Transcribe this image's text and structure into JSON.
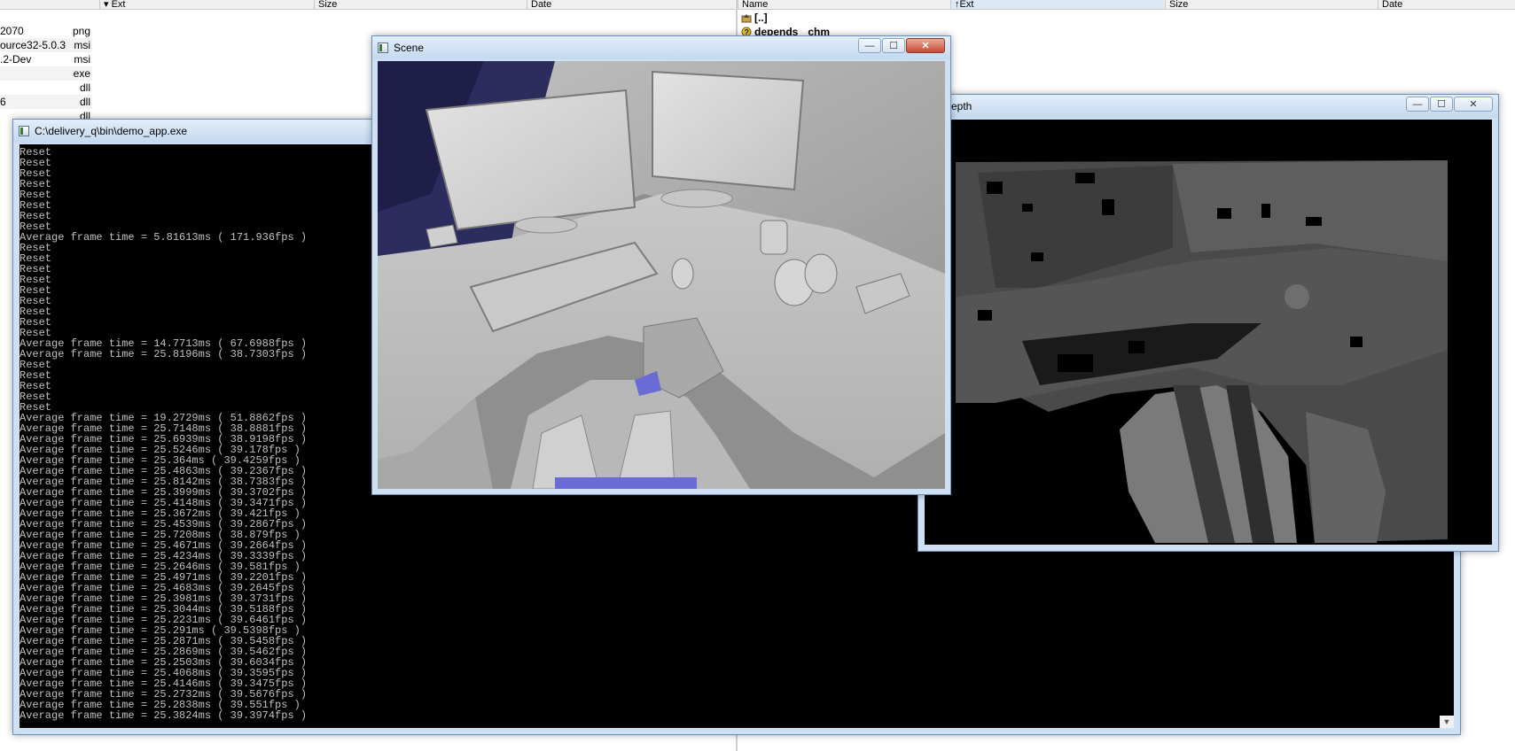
{
  "file_manager": {
    "left_headers": [
      "Ext",
      "Size",
      "Date"
    ],
    "left_rows": [
      {
        "name": "2070",
        "ext": "png"
      },
      {
        "name": "ource32-5.0.3",
        "ext": "msi"
      },
      {
        "name": ".2-Dev",
        "ext": "msi"
      },
      {
        "name": "",
        "ext": "exe"
      },
      {
        "name": "",
        "ext": "dll"
      },
      {
        "name": "6",
        "ext": "dll"
      },
      {
        "name": "",
        "ext": "dll"
      }
    ],
    "right_headers": [
      "Name",
      "Ext",
      "Size",
      "Date"
    ],
    "right_rows": [
      {
        "name": "[..]",
        "ext": ""
      },
      {
        "name": "depends",
        "ext": "chm"
      }
    ]
  },
  "console": {
    "title": "C:\\delivery_q\\bin\\demo_app.exe",
    "lines": [
      "Reset",
      "Reset",
      "Reset",
      "Reset",
      "Reset",
      "Reset",
      "Reset",
      "Reset",
      "Average frame time = 5.81613ms ( 171.936fps )",
      "Reset",
      "Reset",
      "Reset",
      "Reset",
      "Reset",
      "Reset",
      "Reset",
      "Reset",
      "Reset",
      "Average frame time = 14.7713ms ( 67.6988fps )",
      "Average frame time = 25.8196ms ( 38.7303fps )",
      "Reset",
      "Reset",
      "Reset",
      "Reset",
      "Reset",
      "Average frame time = 19.2729ms ( 51.8862fps )",
      "Average frame time = 25.7148ms ( 38.8881fps )",
      "Average frame time = 25.6939ms ( 38.9198fps )",
      "Average frame time = 25.5246ms ( 39.178fps )",
      "Average frame time = 25.364ms ( 39.4259fps )",
      "Average frame time = 25.4863ms ( 39.2367fps )",
      "Average frame time = 25.8142ms ( 38.7383fps )",
      "Average frame time = 25.3999ms ( 39.3702fps )",
      "Average frame time = 25.4148ms ( 39.3471fps )",
      "Average frame time = 25.3672ms ( 39.421fps )",
      "Average frame time = 25.4539ms ( 39.2867fps )",
      "Average frame time = 25.7208ms ( 38.879fps )",
      "Average frame time = 25.4671ms ( 39.2664fps )",
      "Average frame time = 25.4234ms ( 39.3339fps )",
      "Average frame time = 25.2646ms ( 39.581fps )",
      "Average frame time = 25.4971ms ( 39.2201fps )",
      "Average frame time = 25.4683ms ( 39.2645fps )",
      "Average frame time = 25.3981ms ( 39.3731fps )",
      "Average frame time = 25.3044ms ( 39.5188fps )",
      "Average frame time = 25.2231ms ( 39.6461fps )",
      "Average frame time = 25.291ms ( 39.5398fps )",
      "Average frame time = 25.2871ms ( 39.5458fps )",
      "Average frame time = 25.2869ms ( 39.5462fps )",
      "Average frame time = 25.2503ms ( 39.6034fps )",
      "Average frame time = 25.4068ms ( 39.3595fps )",
      "Average frame time = 25.4146ms ( 39.3475fps )",
      "Average frame time = 25.2732ms ( 39.5676fps )",
      "Average frame time = 25.2838ms ( 39.551fps )",
      "Average frame time = 25.3824ms ( 39.3974fps )"
    ]
  },
  "scene_window": {
    "title": "Scene"
  },
  "depth_window": {
    "title": "epth"
  },
  "window_controls": {
    "minimize": "—",
    "maximize": "☐",
    "close": "✕"
  },
  "colors": {
    "titlebar": "#c4d9ef",
    "console_bg": "#000000",
    "console_text": "#c0c0c0",
    "mesh": "#b4b4b4",
    "void": "#6b6bd6"
  }
}
